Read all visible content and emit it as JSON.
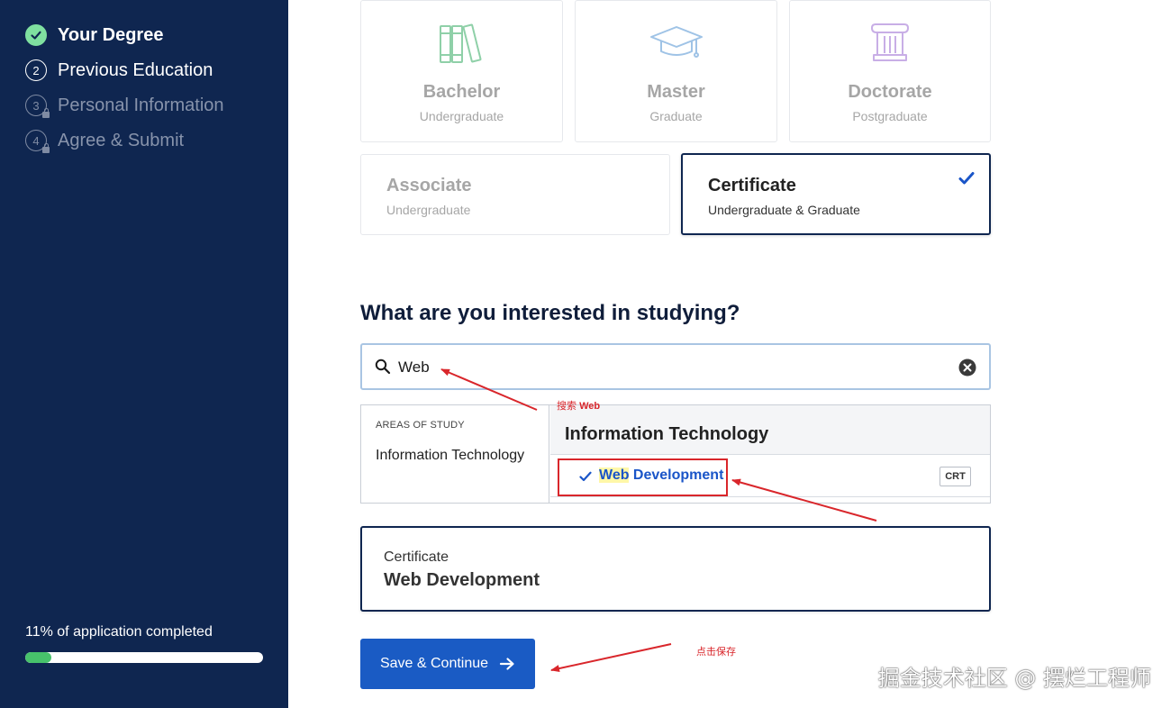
{
  "sidebar": {
    "steps": [
      {
        "number": "",
        "label": "Your Degree"
      },
      {
        "number": "2",
        "label": "Previous Education"
      },
      {
        "number": "3",
        "label": "Personal Information"
      },
      {
        "number": "4",
        "label": "Agree & Submit"
      }
    ],
    "progress_text": "11% of application completed",
    "progress_percent": 11
  },
  "degrees": [
    {
      "title": "Bachelor",
      "subtitle": "Undergraduate",
      "icon": "books-icon"
    },
    {
      "title": "Master",
      "subtitle": "Graduate",
      "icon": "graduation-cap-icon"
    },
    {
      "title": "Doctorate",
      "subtitle": "Postgraduate",
      "icon": "column-icon"
    },
    {
      "title": "Associate",
      "subtitle": "Undergraduate"
    },
    {
      "title": "Certificate",
      "subtitle": "Undergraduate & Graduate",
      "selected": true
    }
  ],
  "study": {
    "question": "What are you interested in studying?",
    "search_value": "Web",
    "areas_header": "AREAS OF STUDY",
    "area_item": "Information Technology",
    "programs_header": "Information Technology",
    "program": {
      "highlight": "Web",
      "rest": " Development",
      "badge": "CRT"
    }
  },
  "selection": {
    "type": "Certificate",
    "name": "Web Development"
  },
  "save_button": {
    "label": "Save & Continue"
  },
  "annotations": {
    "search_note_prefix": "搜索",
    "search_note_term": "Web",
    "save_note": "点击保存"
  },
  "watermark": "掘金技术社区 @ 摆烂工程师",
  "colors": {
    "sidebar_bg": "#0f2650",
    "accent_blue": "#1a5bc4",
    "done_green": "#7fe0a0",
    "annotation_red": "#d9262b"
  }
}
